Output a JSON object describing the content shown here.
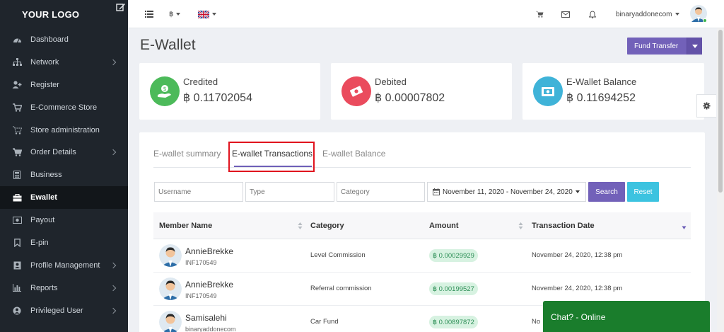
{
  "brand": {
    "logo_text": "YOUR LOGO"
  },
  "sidebar": {
    "items": [
      {
        "label": "Dashboard",
        "icon": "dashboard-icon",
        "has_children": false
      },
      {
        "label": "Network",
        "icon": "sitemap-icon",
        "has_children": true
      },
      {
        "label": "Register",
        "icon": "user-plus-icon",
        "has_children": false
      },
      {
        "label": "E-Commerce Store",
        "icon": "cart-icon",
        "has_children": false
      },
      {
        "label": "Store administration",
        "icon": "cart-outline-icon",
        "has_children": false
      },
      {
        "label": "Order Details",
        "icon": "cart-icon",
        "has_children": true
      },
      {
        "label": "Business",
        "icon": "calculator-icon",
        "has_children": false
      },
      {
        "label": "Ewallet",
        "icon": "briefcase-icon",
        "has_children": false,
        "active": true
      },
      {
        "label": "Payout",
        "icon": "money-icon",
        "has_children": false
      },
      {
        "label": "E-pin",
        "icon": "bookmark-icon",
        "has_children": false
      },
      {
        "label": "Profile Management",
        "icon": "profile-icon",
        "has_children": true
      },
      {
        "label": "Reports",
        "icon": "bar-chart-icon",
        "has_children": true
      },
      {
        "label": "Privileged User",
        "icon": "user-circle-icon",
        "has_children": true
      }
    ]
  },
  "topbar": {
    "currency_symbol": "฿",
    "username": "binaryaddonecom"
  },
  "page": {
    "title": "E-Wallet",
    "fund_transfer_label": "Fund Transfer"
  },
  "stats": {
    "credited": {
      "label": "Credited",
      "value": "฿ 0.11702054",
      "color": "#4cba5a"
    },
    "debited": {
      "label": "Debited",
      "value": "฿ 0.00007802",
      "color": "#ea4b5d"
    },
    "balance": {
      "label": "E-Wallet Balance",
      "value": "฿ 0.11694252",
      "color": "#3fb3d8"
    }
  },
  "tabs": {
    "summary": "E-wallet summary",
    "transactions": "E-wallet Transactions",
    "balance": "E-wallet Balance"
  },
  "filters": {
    "username_placeholder": "Username",
    "type_placeholder": "Type",
    "category_placeholder": "Category",
    "date_range": "November 11, 2020 - November 24, 2020",
    "search_label": "Search",
    "reset_label": "Reset"
  },
  "table": {
    "headers": {
      "member": "Member Name",
      "category": "Category",
      "amount": "Amount",
      "date": "Transaction Date"
    },
    "rows": [
      {
        "name": "AnnieBrekke",
        "id": "INF170549",
        "category": "Level Commission",
        "amount": "฿ 0.00029929",
        "date": "November 24, 2020, 12:38 pm"
      },
      {
        "name": "AnnieBrekke",
        "id": "INF170549",
        "category": "Referral commission",
        "amount": "฿ 0.00199527",
        "date": "November 24, 2020, 12:38 pm"
      },
      {
        "name": "Samisalehi",
        "id": "binaryaddonecom",
        "category": "Car Fund",
        "amount": "฿ 0.00897872",
        "date": "No"
      }
    ]
  },
  "chat": {
    "label": "Chat? - Online"
  },
  "colors": {
    "sidebar_bg": "#1f252c",
    "accent_purple": "#7261b9",
    "highlight_red": "#e0141e",
    "chat_green": "#1a7d2c"
  }
}
